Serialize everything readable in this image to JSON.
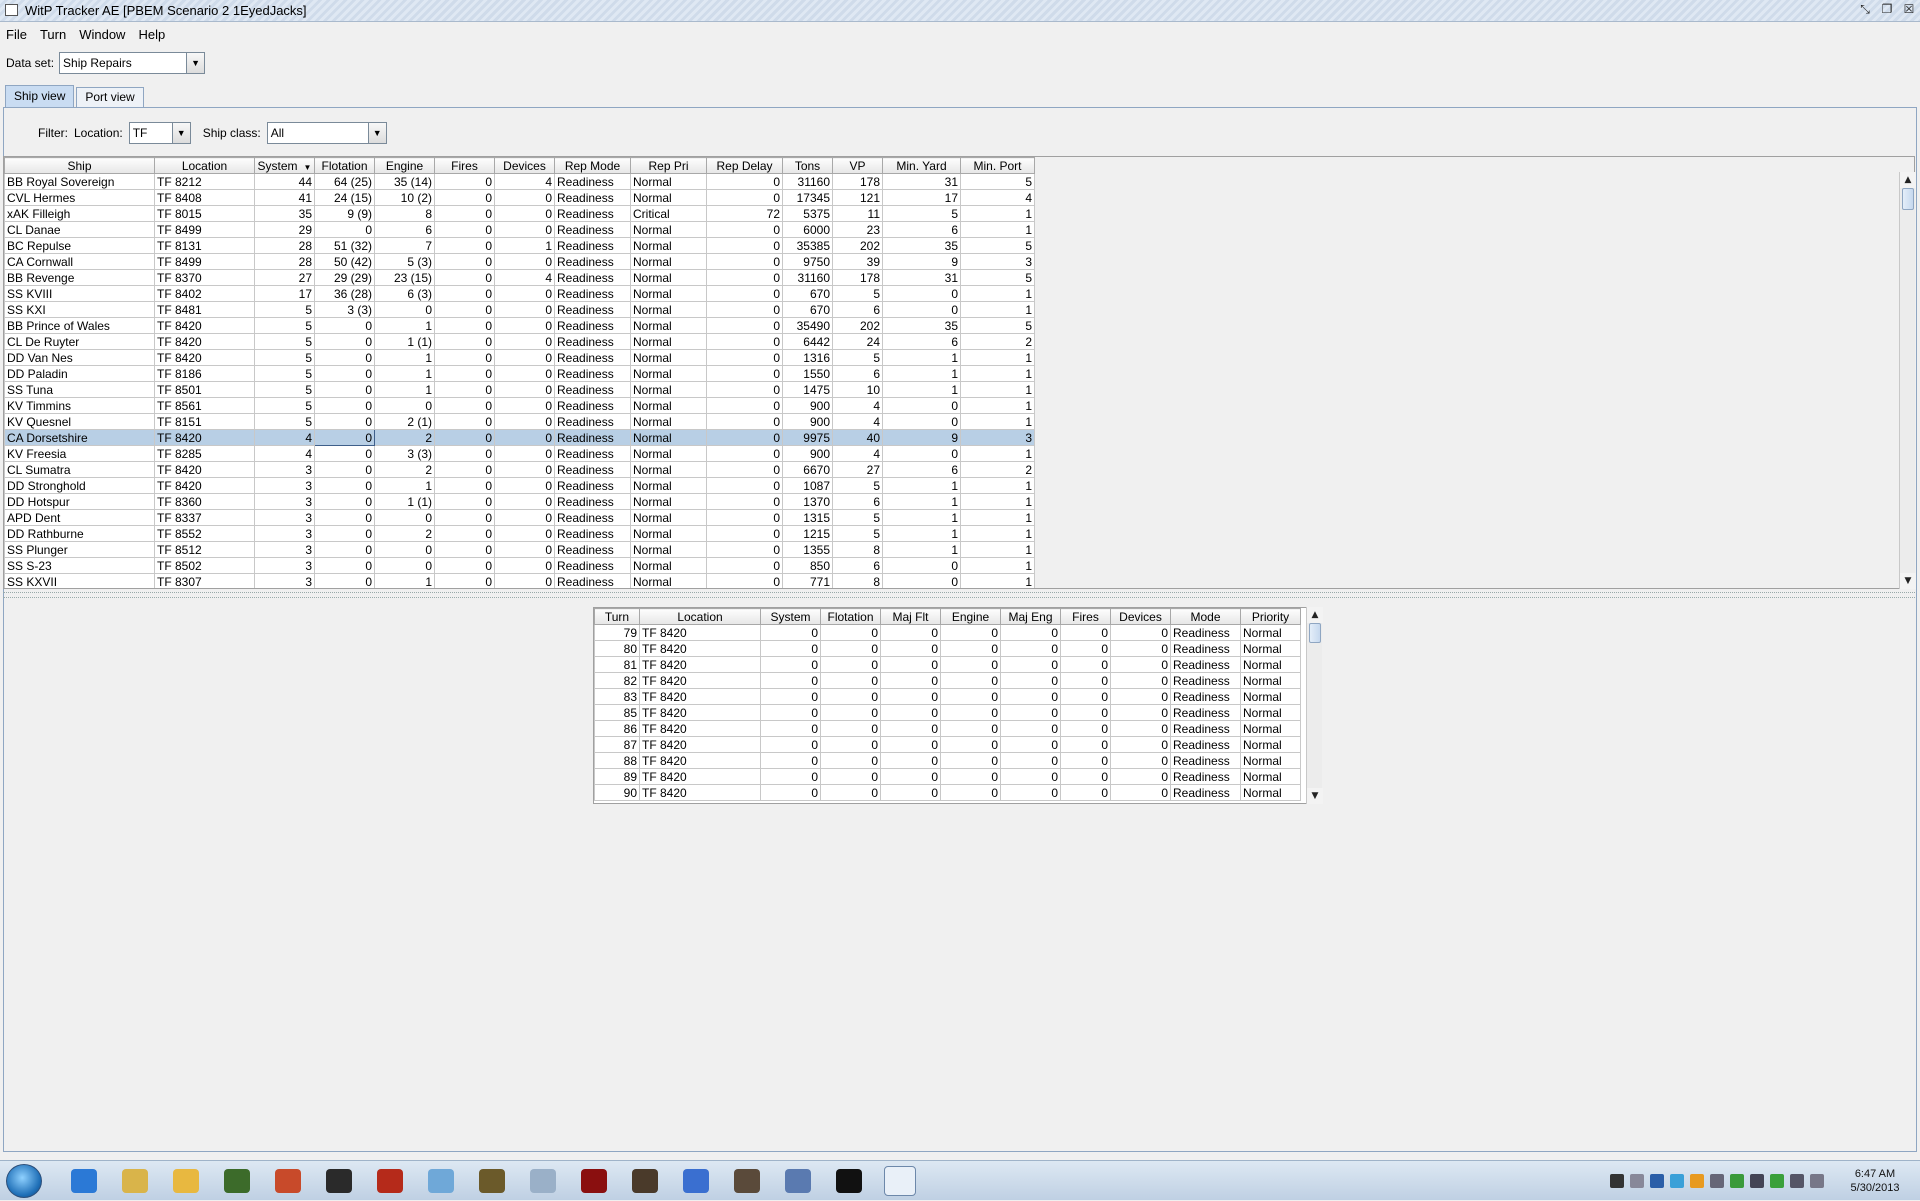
{
  "window": {
    "title": "WitP Tracker AE [PBEM Scenario 2 1EyedJacks]"
  },
  "menu": [
    "File",
    "Turn",
    "Window",
    "Help"
  ],
  "dataset": {
    "label": "Data set:",
    "value": "Ship Repairs"
  },
  "tabs": [
    "Ship view",
    "Port view"
  ],
  "filter": {
    "title": "Filter:",
    "location_label": "Location:",
    "location_value": "TF",
    "shipclass_label": "Ship class:",
    "shipclass_value": "All"
  },
  "ships": {
    "headers": [
      "Ship",
      "Location",
      "System",
      "Flotation",
      "Engine",
      "Fires",
      "Devices",
      "Rep Mode",
      "Rep Pri",
      "Rep Delay",
      "Tons",
      "VP",
      "Min. Yard",
      "Min. Port"
    ],
    "sort_indicator": "▼",
    "selected_row": 16,
    "rows": [
      [
        "BB Royal Sovereign",
        "TF 8212",
        "44",
        "64 (25)",
        "35 (14)",
        "0",
        "4",
        "Readiness",
        "Normal",
        "0",
        "31160",
        "178",
        "31",
        "5"
      ],
      [
        "CVL Hermes",
        "TF 8408",
        "41",
        "24 (15)",
        "10 (2)",
        "0",
        "0",
        "Readiness",
        "Normal",
        "0",
        "17345",
        "121",
        "17",
        "4"
      ],
      [
        "xAK Filleigh",
        "TF 8015",
        "35",
        "9 (9)",
        "8",
        "0",
        "0",
        "Readiness",
        "Critical",
        "72",
        "5375",
        "11",
        "5",
        "1"
      ],
      [
        "CL Danae",
        "TF 8499",
        "29",
        "0",
        "6",
        "0",
        "0",
        "Readiness",
        "Normal",
        "0",
        "6000",
        "23",
        "6",
        "1"
      ],
      [
        "BC Repulse",
        "TF 8131",
        "28",
        "51 (32)",
        "7",
        "0",
        "1",
        "Readiness",
        "Normal",
        "0",
        "35385",
        "202",
        "35",
        "5"
      ],
      [
        "CA Cornwall",
        "TF 8499",
        "28",
        "50 (42)",
        "5 (3)",
        "0",
        "0",
        "Readiness",
        "Normal",
        "0",
        "9750",
        "39",
        "9",
        "3"
      ],
      [
        "BB Revenge",
        "TF 8370",
        "27",
        "29 (29)",
        "23 (15)",
        "0",
        "4",
        "Readiness",
        "Normal",
        "0",
        "31160",
        "178",
        "31",
        "5"
      ],
      [
        "SS KVIII",
        "TF 8402",
        "17",
        "36 (28)",
        "6 (3)",
        "0",
        "0",
        "Readiness",
        "Normal",
        "0",
        "670",
        "5",
        "0",
        "1"
      ],
      [
        "SS KXI",
        "TF 8481",
        "5",
        "3 (3)",
        "0",
        "0",
        "0",
        "Readiness",
        "Normal",
        "0",
        "670",
        "6",
        "0",
        "1"
      ],
      [
        "BB Prince of Wales",
        "TF 8420",
        "5",
        "0",
        "1",
        "0",
        "0",
        "Readiness",
        "Normal",
        "0",
        "35490",
        "202",
        "35",
        "5"
      ],
      [
        "CL De Ruyter",
        "TF 8420",
        "5",
        "0",
        "1 (1)",
        "0",
        "0",
        "Readiness",
        "Normal",
        "0",
        "6442",
        "24",
        "6",
        "2"
      ],
      [
        "DD Van Nes",
        "TF 8420",
        "5",
        "0",
        "1",
        "0",
        "0",
        "Readiness",
        "Normal",
        "0",
        "1316",
        "5",
        "1",
        "1"
      ],
      [
        "DD Paladin",
        "TF 8186",
        "5",
        "0",
        "1",
        "0",
        "0",
        "Readiness",
        "Normal",
        "0",
        "1550",
        "6",
        "1",
        "1"
      ],
      [
        "SS Tuna",
        "TF 8501",
        "5",
        "0",
        "1",
        "0",
        "0",
        "Readiness",
        "Normal",
        "0",
        "1475",
        "10",
        "1",
        "1"
      ],
      [
        "KV Timmins",
        "TF 8561",
        "5",
        "0",
        "0",
        "0",
        "0",
        "Readiness",
        "Normal",
        "0",
        "900",
        "4",
        "0",
        "1"
      ],
      [
        "KV Quesnel",
        "TF 8151",
        "5",
        "0",
        "2 (1)",
        "0",
        "0",
        "Readiness",
        "Normal",
        "0",
        "900",
        "4",
        "0",
        "1"
      ],
      [
        "CA Dorsetshire",
        "TF 8420",
        "4",
        "0",
        "2",
        "0",
        "0",
        "Readiness",
        "Normal",
        "0",
        "9975",
        "40",
        "9",
        "3"
      ],
      [
        "KV Freesia",
        "TF 8285",
        "4",
        "0",
        "3 (3)",
        "0",
        "0",
        "Readiness",
        "Normal",
        "0",
        "900",
        "4",
        "0",
        "1"
      ],
      [
        "CL Sumatra",
        "TF 8420",
        "3",
        "0",
        "2",
        "0",
        "0",
        "Readiness",
        "Normal",
        "0",
        "6670",
        "27",
        "6",
        "2"
      ],
      [
        "DD Stronghold",
        "TF 8420",
        "3",
        "0",
        "1",
        "0",
        "0",
        "Readiness",
        "Normal",
        "0",
        "1087",
        "5",
        "1",
        "1"
      ],
      [
        "DD Hotspur",
        "TF 8360",
        "3",
        "0",
        "1 (1)",
        "0",
        "0",
        "Readiness",
        "Normal",
        "0",
        "1370",
        "6",
        "1",
        "1"
      ],
      [
        "APD Dent",
        "TF 8337",
        "3",
        "0",
        "0",
        "0",
        "0",
        "Readiness",
        "Normal",
        "0",
        "1315",
        "5",
        "1",
        "1"
      ],
      [
        "DD Rathburne",
        "TF 8552",
        "3",
        "0",
        "2",
        "0",
        "0",
        "Readiness",
        "Normal",
        "0",
        "1215",
        "5",
        "1",
        "1"
      ],
      [
        "SS Plunger",
        "TF 8512",
        "3",
        "0",
        "0",
        "0",
        "0",
        "Readiness",
        "Normal",
        "0",
        "1355",
        "8",
        "1",
        "1"
      ],
      [
        "SS S-23",
        "TF 8502",
        "3",
        "0",
        "0",
        "0",
        "0",
        "Readiness",
        "Normal",
        "0",
        "850",
        "6",
        "0",
        "1"
      ],
      [
        "SS KXVII",
        "TF 8307",
        "3",
        "0",
        "1",
        "0",
        "0",
        "Readiness",
        "Normal",
        "0",
        "771",
        "8",
        "0",
        "1"
      ]
    ]
  },
  "history": {
    "headers": [
      "Turn",
      "Location",
      "System",
      "Flotation",
      "Maj Flt",
      "Engine",
      "Maj Eng",
      "Fires",
      "Devices",
      "Mode",
      "Priority"
    ],
    "rows": [
      [
        "79",
        "TF 8420",
        "0",
        "0",
        "0",
        "0",
        "0",
        "0",
        "0",
        "Readiness",
        "Normal"
      ],
      [
        "80",
        "TF 8420",
        "0",
        "0",
        "0",
        "0",
        "0",
        "0",
        "0",
        "Readiness",
        "Normal"
      ],
      [
        "81",
        "TF 8420",
        "0",
        "0",
        "0",
        "0",
        "0",
        "0",
        "0",
        "Readiness",
        "Normal"
      ],
      [
        "82",
        "TF 8420",
        "0",
        "0",
        "0",
        "0",
        "0",
        "0",
        "0",
        "Readiness",
        "Normal"
      ],
      [
        "83",
        "TF 8420",
        "0",
        "0",
        "0",
        "0",
        "0",
        "0",
        "0",
        "Readiness",
        "Normal"
      ],
      [
        "85",
        "TF 8420",
        "0",
        "0",
        "0",
        "0",
        "0",
        "0",
        "0",
        "Readiness",
        "Normal"
      ],
      [
        "86",
        "TF 8420",
        "0",
        "0",
        "0",
        "0",
        "0",
        "0",
        "0",
        "Readiness",
        "Normal"
      ],
      [
        "87",
        "TF 8420",
        "0",
        "0",
        "0",
        "0",
        "0",
        "0",
        "0",
        "Readiness",
        "Normal"
      ],
      [
        "88",
        "TF 8420",
        "0",
        "0",
        "0",
        "0",
        "0",
        "0",
        "0",
        "Readiness",
        "Normal"
      ],
      [
        "89",
        "TF 8420",
        "0",
        "0",
        "0",
        "0",
        "0",
        "0",
        "0",
        "Readiness",
        "Normal"
      ],
      [
        "90",
        "TF 8420",
        "0",
        "0",
        "0",
        "0",
        "0",
        "0",
        "0",
        "Readiness",
        "Normal"
      ]
    ]
  },
  "taskbar": {
    "icons": [
      "internet-explorer-icon",
      "file-explorer-icon",
      "outlook-icon",
      "game-icon-1",
      "parrot-icon",
      "rank-insignia-icon",
      "red-circle-app-icon",
      "notepad-icon",
      "game-icon-2",
      "paint-icon",
      "sins-icon",
      "commander-icon",
      "itunes-icon",
      "skyrim-icon",
      "editor-icon",
      "command-prompt-icon",
      "java-icon"
    ],
    "icon_colors": [
      "#2b79d6",
      "#d9b44a",
      "#e8b840",
      "#3c6b2a",
      "#c84a2a",
      "#2a2a2a",
      "#b52a1a",
      "#6fa8d8",
      "#6b5a2a",
      "#9ab0c8",
      "#8a0f0f",
      "#4a3a2a",
      "#3a6fd0",
      "#5a4a3a",
      "#5a7ab0",
      "#111111",
      "#e9f0f8"
    ],
    "clock_time": "6:47 AM",
    "clock_date": "5/30/2013"
  }
}
